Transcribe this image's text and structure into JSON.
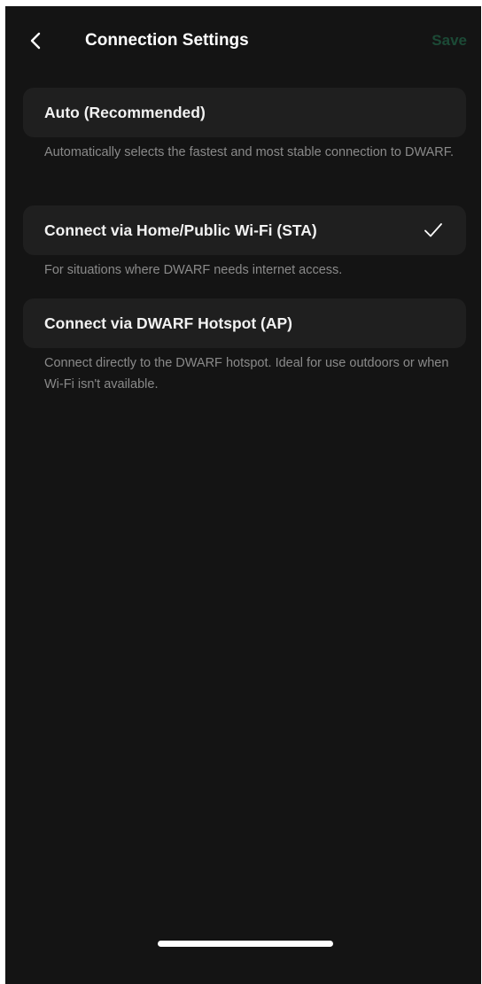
{
  "header": {
    "back_icon": "chevron-left-icon",
    "title": "Connection Settings",
    "save_label": "Save",
    "save_color": "#1c4a36"
  },
  "options": [
    {
      "label": "Auto (Recommended)",
      "description": "Automatically selects the fastest and most stable connection to DWARF.",
      "selected": false
    },
    {
      "label": "Connect via Home/Public Wi-Fi (STA)",
      "description": "For situations where DWARF needs internet access.",
      "selected": true,
      "selected_icon": "checkmark-icon"
    },
    {
      "label": "Connect via DWARF Hotspot (AP)",
      "description": "Connect directly to the DWARF hotspot. Ideal for use outdoors or when Wi-Fi isn't available.",
      "selected": false
    }
  ],
  "colors": {
    "background": "#141414",
    "card": "#1f1f1f",
    "description_text": "#8a8a8a"
  }
}
